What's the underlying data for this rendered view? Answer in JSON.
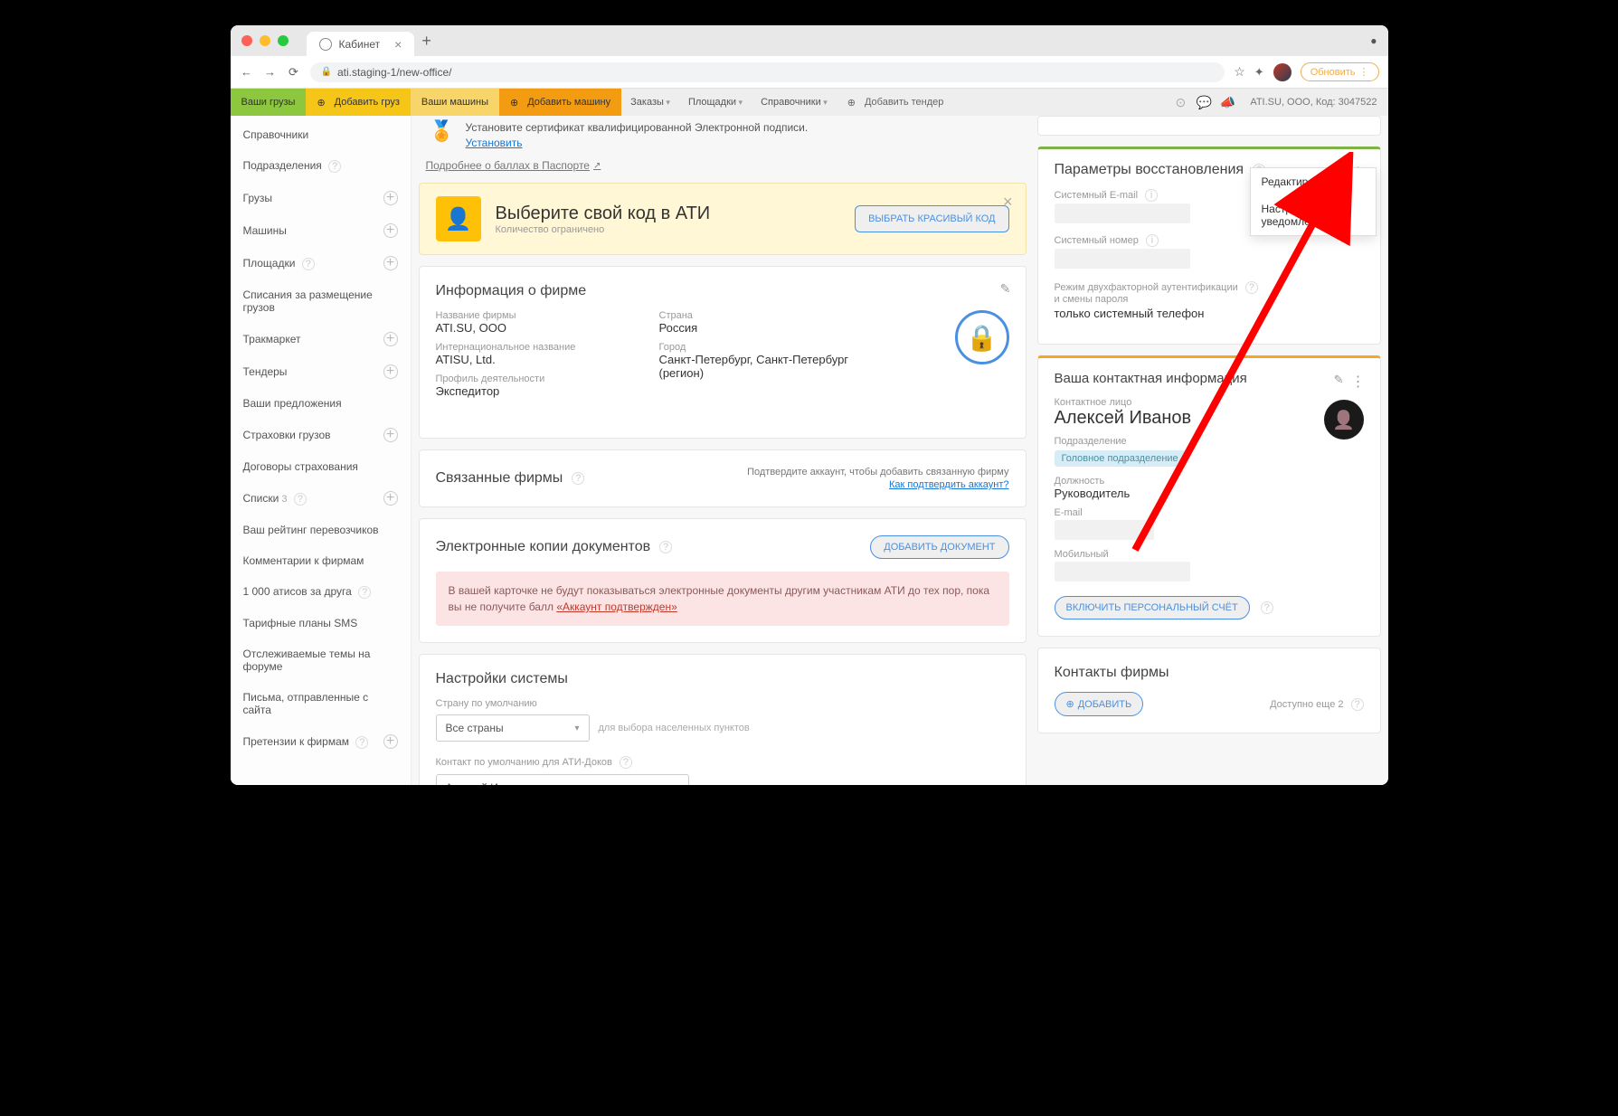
{
  "browser": {
    "tab_title": "Кабинет",
    "url": "ati.staging-1/new-office/",
    "refresh_label": "Обновить"
  },
  "topmenu": {
    "your_cargo": "Ваши грузы",
    "add_cargo": "Добавить груз",
    "your_vehicles": "Ваши машины",
    "add_vehicle": "Добавить машину",
    "orders": "Заказы",
    "platforms": "Площадки",
    "directories": "Справочники",
    "add_tender": "Добавить тендер",
    "company": "ATI.SU, ООО,",
    "code": "Код: 3047522"
  },
  "sidebar": [
    {
      "label": "Справочники",
      "plus": false
    },
    {
      "label": "Подразделения",
      "help": true,
      "plus": false
    },
    {
      "label": "Грузы",
      "plus": true
    },
    {
      "label": "Машины",
      "plus": true
    },
    {
      "label": "Площадки",
      "help": true,
      "plus": true
    },
    {
      "label": "Списания за размещение грузов",
      "plus": false
    },
    {
      "label": "Тракмаркет",
      "plus": true
    },
    {
      "label": "Тендеры",
      "plus": true
    },
    {
      "label": "Ваши предложения",
      "plus": false
    },
    {
      "label": "Страховки грузов",
      "plus": true
    },
    {
      "label": "Договоры страхования",
      "plus": false
    },
    {
      "label": "Списки",
      "count": "3",
      "help": true,
      "plus": true
    },
    {
      "label": "Ваш рейтинг перевозчиков",
      "plus": false
    },
    {
      "label": "Комментарии к фирмам",
      "plus": false
    },
    {
      "label": "1 000 атисов за друга",
      "help": true,
      "plus": false
    },
    {
      "label": "Тарифные планы SMS",
      "plus": false
    },
    {
      "label": "Отслеживаемые темы на форуме",
      "plus": false
    },
    {
      "label": "Письма, отправленные с сайта",
      "plus": false
    },
    {
      "label": "Претензии к фирмам",
      "help": true,
      "plus": true
    }
  ],
  "cert": {
    "text": "Установите сертификат квалифицированной Электронной подписи.",
    "install": "Установить",
    "more": "Подробнее о баллах в Паспорте"
  },
  "promo": {
    "title": "Выберите свой код в АТИ",
    "sub": "Количество ограничено",
    "button": "ВЫБРАТЬ КРАСИВЫЙ КОД"
  },
  "companyInfo": {
    "title": "Информация о фирме",
    "name_label": "Название фирмы",
    "name": "ATI.SU, ООО",
    "intl_label": "Интернациональное название",
    "intl": "ATISU, Ltd.",
    "profile_label": "Профиль деятельности",
    "profile": "Экспедитор",
    "country_label": "Страна",
    "country": "Россия",
    "city_label": "Город",
    "city": "Санкт-Петербург, Санкт-Петербург (регион)"
  },
  "linked": {
    "title": "Связанные фирмы",
    "hint": "Подтвердите аккаунт, чтобы добавить связанную фирму",
    "link": "Как подтвердить аккаунт?"
  },
  "docs": {
    "title": "Электронные копии документов",
    "add": "ДОБАВИТЬ ДОКУМЕНТ",
    "alert_pre": "В вашей карточке не будут показываться электронные документы другим участникам АТИ до тех пор, пока вы не получите балл ",
    "alert_link": "«Аккаунт подтвержден»"
  },
  "settings": {
    "title": "Настройки системы",
    "country_label": "Страну по умолчанию",
    "country_value": "Все страны",
    "country_hint": "для выбора населенных пунктов",
    "contact_label": "Контакт по умолчанию для АТИ-Доков",
    "contact_value": "Алексей Иванов"
  },
  "recovery": {
    "title": "Параметры восстановления",
    "email_label": "Системный E-mail",
    "phone_label": "Системный номер",
    "twofa_label": "Режим двухфакторной аутентификации",
    "twofa_label2": "и смены пароля",
    "twofa_value": "только системный телефон",
    "menu_edit": "Редактировать",
    "menu_notif": "Настройки уведомлений"
  },
  "contact": {
    "title": "Ваша контактная информация",
    "person_label": "Контактное лицо",
    "person": "Алексей Иванов",
    "dept_label": "Подразделение",
    "dept": "Головное подразделение",
    "position_label": "Должность",
    "position": "Руководитель",
    "email_label": "E-mail",
    "mobile_label": "Мобильный",
    "enable_btn": "ВКЛЮЧИТЬ ПЕРСОНАЛЬНЫЙ СЧЁТ"
  },
  "firmContacts": {
    "title": "Контакты фирмы",
    "add": "ДОБАВИТЬ",
    "available": "Доступно еще 2"
  }
}
